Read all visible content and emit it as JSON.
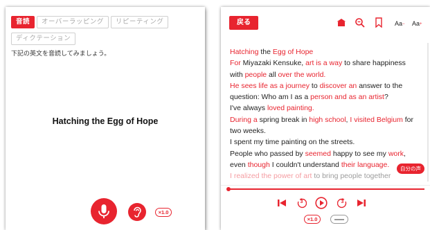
{
  "left_panel": {
    "tabs": [
      {
        "label": "音読",
        "active": true
      },
      {
        "label": "オーバーラッピング",
        "active": false
      },
      {
        "label": "リピーティング",
        "active": false
      },
      {
        "label": "ディクテーション",
        "active": false
      }
    ],
    "instruction": "下記の英文を音読してみましょう。",
    "title": "Hatching the Egg of Hope",
    "speed": "×1.0",
    "icons": [
      "microphone-icon",
      "ear-icon"
    ]
  },
  "right_panel": {
    "back_label": "戻る",
    "font_smaller": "Aa",
    "font_larger": "Aa",
    "icons": [
      "hat-icon",
      "search-icon",
      "bookmark-icon"
    ],
    "lines": [
      [
        {
          "t": "Hatching",
          "r": true
        },
        {
          "t": " the "
        },
        {
          "t": "Egg of Hope",
          "r": true
        }
      ],
      [
        {
          "t": "For",
          "r": true
        },
        {
          "t": " Miyazaki Kensuke, "
        },
        {
          "t": "art is a way",
          "r": true
        },
        {
          "t": " to share happiness"
        }
      ],
      [
        {
          "t": "with "
        },
        {
          "t": "people",
          "r": true
        },
        {
          "t": " all "
        },
        {
          "t": "over the world.",
          "r": true
        }
      ],
      [
        {
          "t": "He sees life as a journey",
          "r": true
        },
        {
          "t": " to "
        },
        {
          "t": "discover an",
          "r": true
        },
        {
          "t": " answer to the"
        }
      ],
      [
        {
          "t": "question: Who am I as a "
        },
        {
          "t": "person and as an artist",
          "r": true
        },
        {
          "t": "?"
        }
      ],
      [
        {
          "t": "I've always "
        },
        {
          "t": "loved painting.",
          "r": true
        }
      ],
      [
        {
          "t": "During a",
          "r": true
        },
        {
          "t": " spring break in "
        },
        {
          "t": "high school",
          "r": true
        },
        {
          "t": ", "
        },
        {
          "t": "I visited Belgium",
          "r": true
        },
        {
          "t": " for"
        }
      ],
      [
        {
          "t": "two weeks."
        }
      ],
      [
        {
          "t": "I spent my time painting on the streets."
        }
      ],
      [
        {
          "t": "People who passed by "
        },
        {
          "t": "seemed",
          "r": true
        },
        {
          "t": " happy to see my "
        },
        {
          "t": "work",
          "r": true
        },
        {
          "t": ","
        }
      ],
      [
        {
          "t": "even "
        },
        {
          "t": "though",
          "r": true
        },
        {
          "t": " I couldn't understand "
        },
        {
          "t": "their language.",
          "r": true
        }
      ],
      [
        {
          "t": "I realized the power of art",
          "r": true,
          "f": true
        },
        {
          "t": " to bring people together",
          "f": true
        }
      ]
    ],
    "own_voice_badge": "自分の声",
    "speed": "×1.0",
    "skip_back_seconds": "3",
    "skip_forward_seconds": "3",
    "progress_fraction": 0.0
  },
  "colors": {
    "accent": "#e8242f"
  }
}
